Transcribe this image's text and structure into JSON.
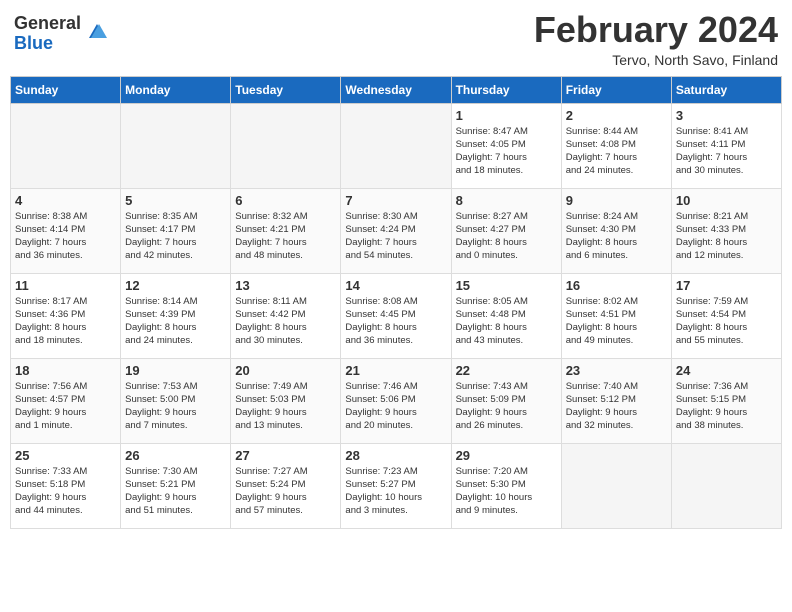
{
  "header": {
    "logo_line1": "General",
    "logo_line2": "Blue",
    "month_title": "February 2024",
    "location": "Tervo, North Savo, Finland"
  },
  "weekdays": [
    "Sunday",
    "Monday",
    "Tuesday",
    "Wednesday",
    "Thursday",
    "Friday",
    "Saturday"
  ],
  "weeks": [
    [
      {
        "day": "",
        "info": ""
      },
      {
        "day": "",
        "info": ""
      },
      {
        "day": "",
        "info": ""
      },
      {
        "day": "",
        "info": ""
      },
      {
        "day": "1",
        "info": "Sunrise: 8:47 AM\nSunset: 4:05 PM\nDaylight: 7 hours\nand 18 minutes."
      },
      {
        "day": "2",
        "info": "Sunrise: 8:44 AM\nSunset: 4:08 PM\nDaylight: 7 hours\nand 24 minutes."
      },
      {
        "day": "3",
        "info": "Sunrise: 8:41 AM\nSunset: 4:11 PM\nDaylight: 7 hours\nand 30 minutes."
      }
    ],
    [
      {
        "day": "4",
        "info": "Sunrise: 8:38 AM\nSunset: 4:14 PM\nDaylight: 7 hours\nand 36 minutes."
      },
      {
        "day": "5",
        "info": "Sunrise: 8:35 AM\nSunset: 4:17 PM\nDaylight: 7 hours\nand 42 minutes."
      },
      {
        "day": "6",
        "info": "Sunrise: 8:32 AM\nSunset: 4:21 PM\nDaylight: 7 hours\nand 48 minutes."
      },
      {
        "day": "7",
        "info": "Sunrise: 8:30 AM\nSunset: 4:24 PM\nDaylight: 7 hours\nand 54 minutes."
      },
      {
        "day": "8",
        "info": "Sunrise: 8:27 AM\nSunset: 4:27 PM\nDaylight: 8 hours\nand 0 minutes."
      },
      {
        "day": "9",
        "info": "Sunrise: 8:24 AM\nSunset: 4:30 PM\nDaylight: 8 hours\nand 6 minutes."
      },
      {
        "day": "10",
        "info": "Sunrise: 8:21 AM\nSunset: 4:33 PM\nDaylight: 8 hours\nand 12 minutes."
      }
    ],
    [
      {
        "day": "11",
        "info": "Sunrise: 8:17 AM\nSunset: 4:36 PM\nDaylight: 8 hours\nand 18 minutes."
      },
      {
        "day": "12",
        "info": "Sunrise: 8:14 AM\nSunset: 4:39 PM\nDaylight: 8 hours\nand 24 minutes."
      },
      {
        "day": "13",
        "info": "Sunrise: 8:11 AM\nSunset: 4:42 PM\nDaylight: 8 hours\nand 30 minutes."
      },
      {
        "day": "14",
        "info": "Sunrise: 8:08 AM\nSunset: 4:45 PM\nDaylight: 8 hours\nand 36 minutes."
      },
      {
        "day": "15",
        "info": "Sunrise: 8:05 AM\nSunset: 4:48 PM\nDaylight: 8 hours\nand 43 minutes."
      },
      {
        "day": "16",
        "info": "Sunrise: 8:02 AM\nSunset: 4:51 PM\nDaylight: 8 hours\nand 49 minutes."
      },
      {
        "day": "17",
        "info": "Sunrise: 7:59 AM\nSunset: 4:54 PM\nDaylight: 8 hours\nand 55 minutes."
      }
    ],
    [
      {
        "day": "18",
        "info": "Sunrise: 7:56 AM\nSunset: 4:57 PM\nDaylight: 9 hours\nand 1 minute."
      },
      {
        "day": "19",
        "info": "Sunrise: 7:53 AM\nSunset: 5:00 PM\nDaylight: 9 hours\nand 7 minutes."
      },
      {
        "day": "20",
        "info": "Sunrise: 7:49 AM\nSunset: 5:03 PM\nDaylight: 9 hours\nand 13 minutes."
      },
      {
        "day": "21",
        "info": "Sunrise: 7:46 AM\nSunset: 5:06 PM\nDaylight: 9 hours\nand 20 minutes."
      },
      {
        "day": "22",
        "info": "Sunrise: 7:43 AM\nSunset: 5:09 PM\nDaylight: 9 hours\nand 26 minutes."
      },
      {
        "day": "23",
        "info": "Sunrise: 7:40 AM\nSunset: 5:12 PM\nDaylight: 9 hours\nand 32 minutes."
      },
      {
        "day": "24",
        "info": "Sunrise: 7:36 AM\nSunset: 5:15 PM\nDaylight: 9 hours\nand 38 minutes."
      }
    ],
    [
      {
        "day": "25",
        "info": "Sunrise: 7:33 AM\nSunset: 5:18 PM\nDaylight: 9 hours\nand 44 minutes."
      },
      {
        "day": "26",
        "info": "Sunrise: 7:30 AM\nSunset: 5:21 PM\nDaylight: 9 hours\nand 51 minutes."
      },
      {
        "day": "27",
        "info": "Sunrise: 7:27 AM\nSunset: 5:24 PM\nDaylight: 9 hours\nand 57 minutes."
      },
      {
        "day": "28",
        "info": "Sunrise: 7:23 AM\nSunset: 5:27 PM\nDaylight: 10 hours\nand 3 minutes."
      },
      {
        "day": "29",
        "info": "Sunrise: 7:20 AM\nSunset: 5:30 PM\nDaylight: 10 hours\nand 9 minutes."
      },
      {
        "day": "",
        "info": ""
      },
      {
        "day": "",
        "info": ""
      }
    ]
  ]
}
